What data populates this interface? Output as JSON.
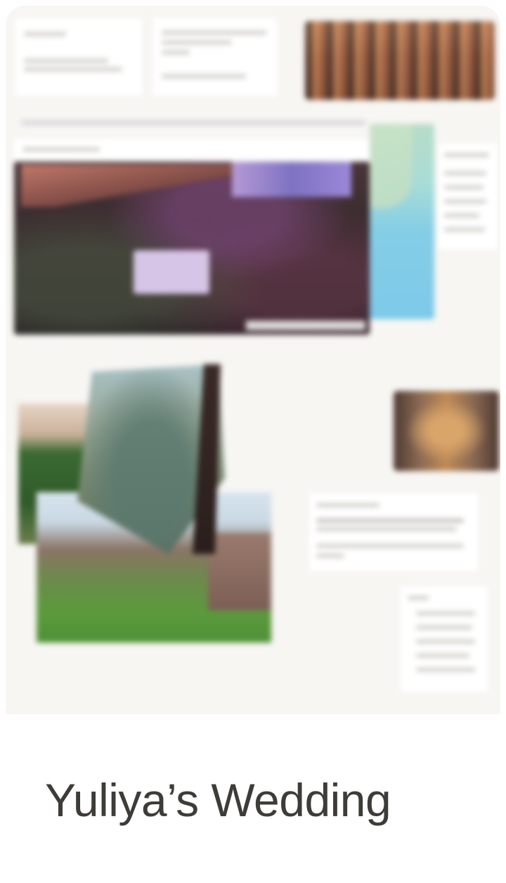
{
  "card": {
    "title": "Yuliya’s Wedding",
    "thumbnail_alt": "Blurred collage board preview"
  },
  "colors": {
    "board_background": "#f7f6f3",
    "title_text": "#3e3c38",
    "page_background": "#ffffff"
  }
}
